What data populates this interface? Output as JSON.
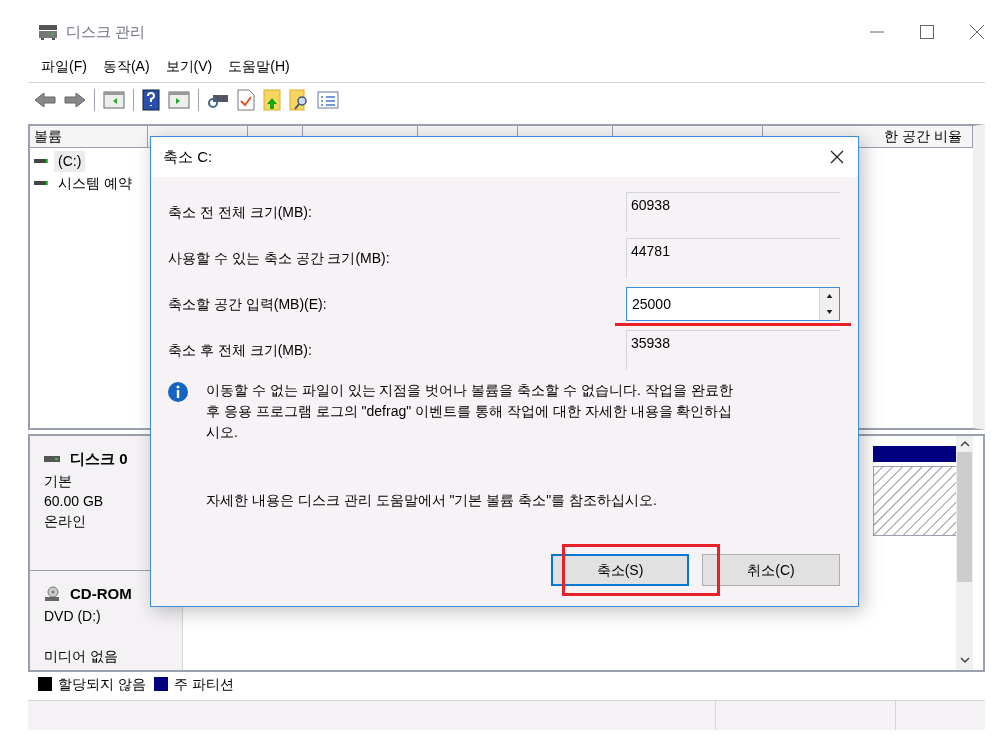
{
  "window": {
    "title": "디스크 관리"
  },
  "menu": [
    "파일(F)",
    "동작(A)",
    "보기(V)",
    "도움말(H)"
  ],
  "volume_list": {
    "columns": [
      {
        "label": "볼륨"
      },
      {
        "label": "한 공간 비율"
      }
    ],
    "rows": [
      {
        "name": "(C:)",
        "selected": true
      },
      {
        "name": "시스템 예약",
        "selected": false
      }
    ]
  },
  "disks": [
    {
      "kind": "disk",
      "name": "디스크 0",
      "lines": [
        "기본",
        "60.00 GB",
        "온라인"
      ]
    },
    {
      "kind": "cdrom",
      "name": "CD-ROM",
      "lines": [
        "DVD (D:)",
        "미디어 없음"
      ]
    }
  ],
  "legend": [
    {
      "label": "할당되지 않음",
      "color": "#000000"
    },
    {
      "label": "주 파티션",
      "color": "#000080"
    }
  ],
  "dialog": {
    "title": "축소 C:",
    "fields": [
      {
        "kind": "readonly",
        "label": "축소 전 전체 크기(MB):",
        "value": "60938"
      },
      {
        "kind": "readonly",
        "label": "사용할 수 있는 축소 공간 크기(MB):",
        "value": "44781"
      },
      {
        "kind": "spin",
        "label": "축소할 공간 입력(MB)(E):",
        "value": "25000"
      },
      {
        "kind": "readonly",
        "label": "축소 후 전체 크기(MB):",
        "value": "35938"
      }
    ],
    "info": "이동할 수 없는 파일이 있는 지점을 벗어나 볼륨을 축소할 수 없습니다. 작업을 완료한 후 응용 프로그램 로그의 \"defrag\" 이벤트를 통해 작업에 대한 자세한 내용을 확인하십시오.",
    "help": "자세한 내용은 디스크 관리 도움말에서 \"기본 볼륨 축소\"를 참조하십시오.",
    "buttons": [
      {
        "label": "축소(S)",
        "default": true
      },
      {
        "label": "취소(C)",
        "default": false
      }
    ]
  }
}
